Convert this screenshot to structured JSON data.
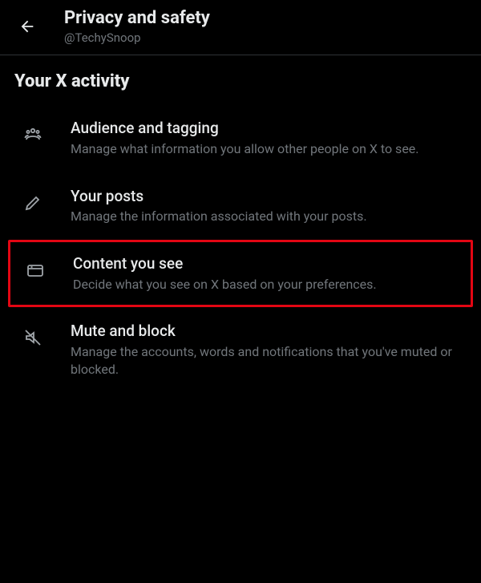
{
  "header": {
    "title": "Privacy and safety",
    "username": "@TechySnoop"
  },
  "section": {
    "title": "Your X activity"
  },
  "menu": [
    {
      "icon": "people-icon",
      "title": "Audience and tagging",
      "desc": "Manage what information you allow other people on X to see.",
      "highlighted": false
    },
    {
      "icon": "pencil-icon",
      "title": "Your posts",
      "desc": "Manage the information associated with your posts.",
      "highlighted": false
    },
    {
      "icon": "content-icon",
      "title": "Content you see",
      "desc": "Decide what you see on X based on your preferences.",
      "highlighted": true
    },
    {
      "icon": "mute-icon",
      "title": "Mute and block",
      "desc": "Manage the accounts, words and notifications that you've muted or blocked.",
      "highlighted": false
    }
  ]
}
